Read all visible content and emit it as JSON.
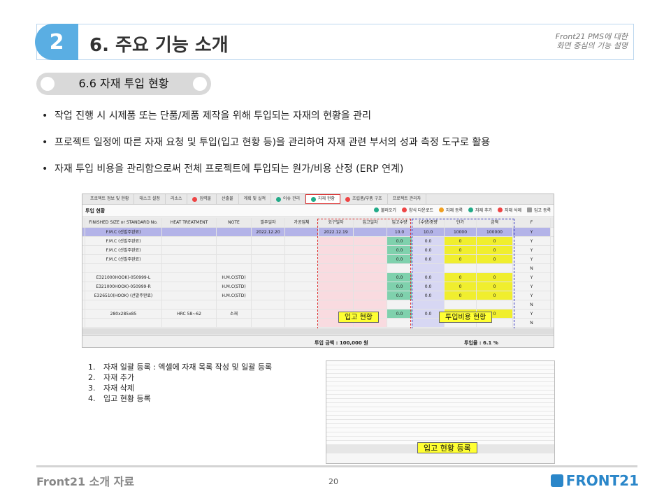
{
  "header": {
    "number": "2",
    "title": "6. 주요 기능 소개",
    "subtitle1": "Front21 PMS에 대한",
    "subtitle2": "화면 중심의 기능 설명"
  },
  "section": {
    "title": "6.6 자재 투입 현황"
  },
  "bullets": [
    "작업 진행 시 시제품 또는 단품/제품 제작을 위해 투입되는 자재의 현황을 관리",
    "프로젝트 일정에 따른 자재 요청 및 투입(입고 현황 등)을 관리하여 자재 관련 부서의 성과 측정 도구로 활용",
    "자재 투입 비용을 관리함으로써 전체 프로젝트에 투입되는 원가/비용 산정 (ERP 연계)"
  ],
  "app": {
    "menu": [
      "프로젝트 정보 및 현황",
      "태스크 설정",
      "리소스",
      "입력물",
      "산출물",
      "계획 및 실적",
      "이슈 관리",
      "자재 현황",
      "조립품/부품 구조",
      "프로젝트 관리자"
    ],
    "toolbar_title": "투입 현황",
    "buttons": [
      "불러오기",
      "양식 다운로드",
      "자재 등록",
      "자재 추가",
      "자재 삭제",
      "입고 등록"
    ],
    "columns": [
      "FINISHED SIZE or STANDARD No.",
      "HEAT TREATMENT",
      "NOTE",
      "발주일자",
      "가공업체",
      "요구일자",
      "입고일자",
      "입고수량",
      "(수량)중량",
      "단가",
      "금액",
      "F"
    ],
    "rows": [
      {
        "c1": "F.M.C (선발주완료)",
        "c2": "",
        "c3": "",
        "c4": "2022.12.20",
        "c6": "2022.12.19",
        "c8": "10.0",
        "c9": "10.0",
        "c10": "10000",
        "c11": "100000",
        "f": "Y",
        "sel": true
      },
      {
        "c1": "F.M.C (선발주완료)",
        "c2": "",
        "c3": "",
        "c4": "",
        "c6": "",
        "c8": "0.0",
        "c9": "0.0",
        "c10": "0",
        "c11": "0",
        "f": "Y"
      },
      {
        "c1": "F.M.C (선발주완료)",
        "c2": "",
        "c3": "",
        "c4": "",
        "c6": "",
        "c8": "0.0",
        "c9": "0.0",
        "c10": "0",
        "c11": "0",
        "f": "Y"
      },
      {
        "c1": "F.M.C (선발주완료)",
        "c2": "",
        "c3": "",
        "c4": "",
        "c6": "",
        "c8": "0.0",
        "c9": "0.0",
        "c10": "0",
        "c11": "0",
        "f": "Y"
      },
      {
        "c1": "",
        "c2": "",
        "c3": "",
        "c4": "",
        "c6": "",
        "c8": "",
        "c9": "",
        "c10": "",
        "c11": "",
        "f": "N"
      },
      {
        "c1": "E321000HOOK)-050999-L",
        "c2": "",
        "c3": "H.M.C(STD)",
        "c4": "",
        "c6": "",
        "c8": "0.0",
        "c9": "0.0",
        "c10": "0",
        "c11": "0",
        "f": "Y"
      },
      {
        "c1": "E321000HOOK)-050999-R",
        "c2": "",
        "c3": "H.M.C(STD)",
        "c4": "",
        "c6": "",
        "c8": "0.0",
        "c9": "0.0",
        "c10": "0",
        "c11": "0",
        "f": "Y"
      },
      {
        "c1": "E326510(HOOK) (선발주완료)",
        "c2": "",
        "c3": "H.M.C(STD)",
        "c4": "",
        "c6": "",
        "c8": "0.0",
        "c9": "0.0",
        "c10": "0",
        "c11": "0",
        "f": "Y"
      },
      {
        "c1": "",
        "c2": "",
        "c3": "",
        "c4": "",
        "c6": "",
        "c8": "",
        "c9": "",
        "c10": "",
        "c11": "",
        "f": "N"
      },
      {
        "c1": "280x285x85",
        "c2": "HRC 58~62",
        "c3": "소재",
        "c4": "",
        "c6": "",
        "c8": "0.0",
        "c9": "0.0",
        "c10": "0",
        "c11": "0",
        "f": "Y"
      },
      {
        "c1": "",
        "c2": "",
        "c3": "",
        "c4": "",
        "c6": "",
        "c8": "",
        "c9": "",
        "c10": "",
        "c11": "",
        "f": "N"
      }
    ],
    "label_in": "입고 현황",
    "label_cost": "투입비용 현황",
    "footer_total": "투입 금액 : 100,000 원",
    "footer_rate": "투입율 : 6.1 %"
  },
  "steps": [
    "자재 일괄 등록 : 엑셀에 자재 목록 작성 및 일괄 등록",
    "자재 추가",
    "자재 삭제",
    "입고 현황 등록"
  ],
  "thumb_label": "입고 현황 등록",
  "footer": {
    "left": "Front21 소개 자료",
    "page": "20",
    "logo": "FRONT21"
  },
  "colors": {
    "accent": "#5aaee3",
    "logo": "#2a86c9"
  }
}
